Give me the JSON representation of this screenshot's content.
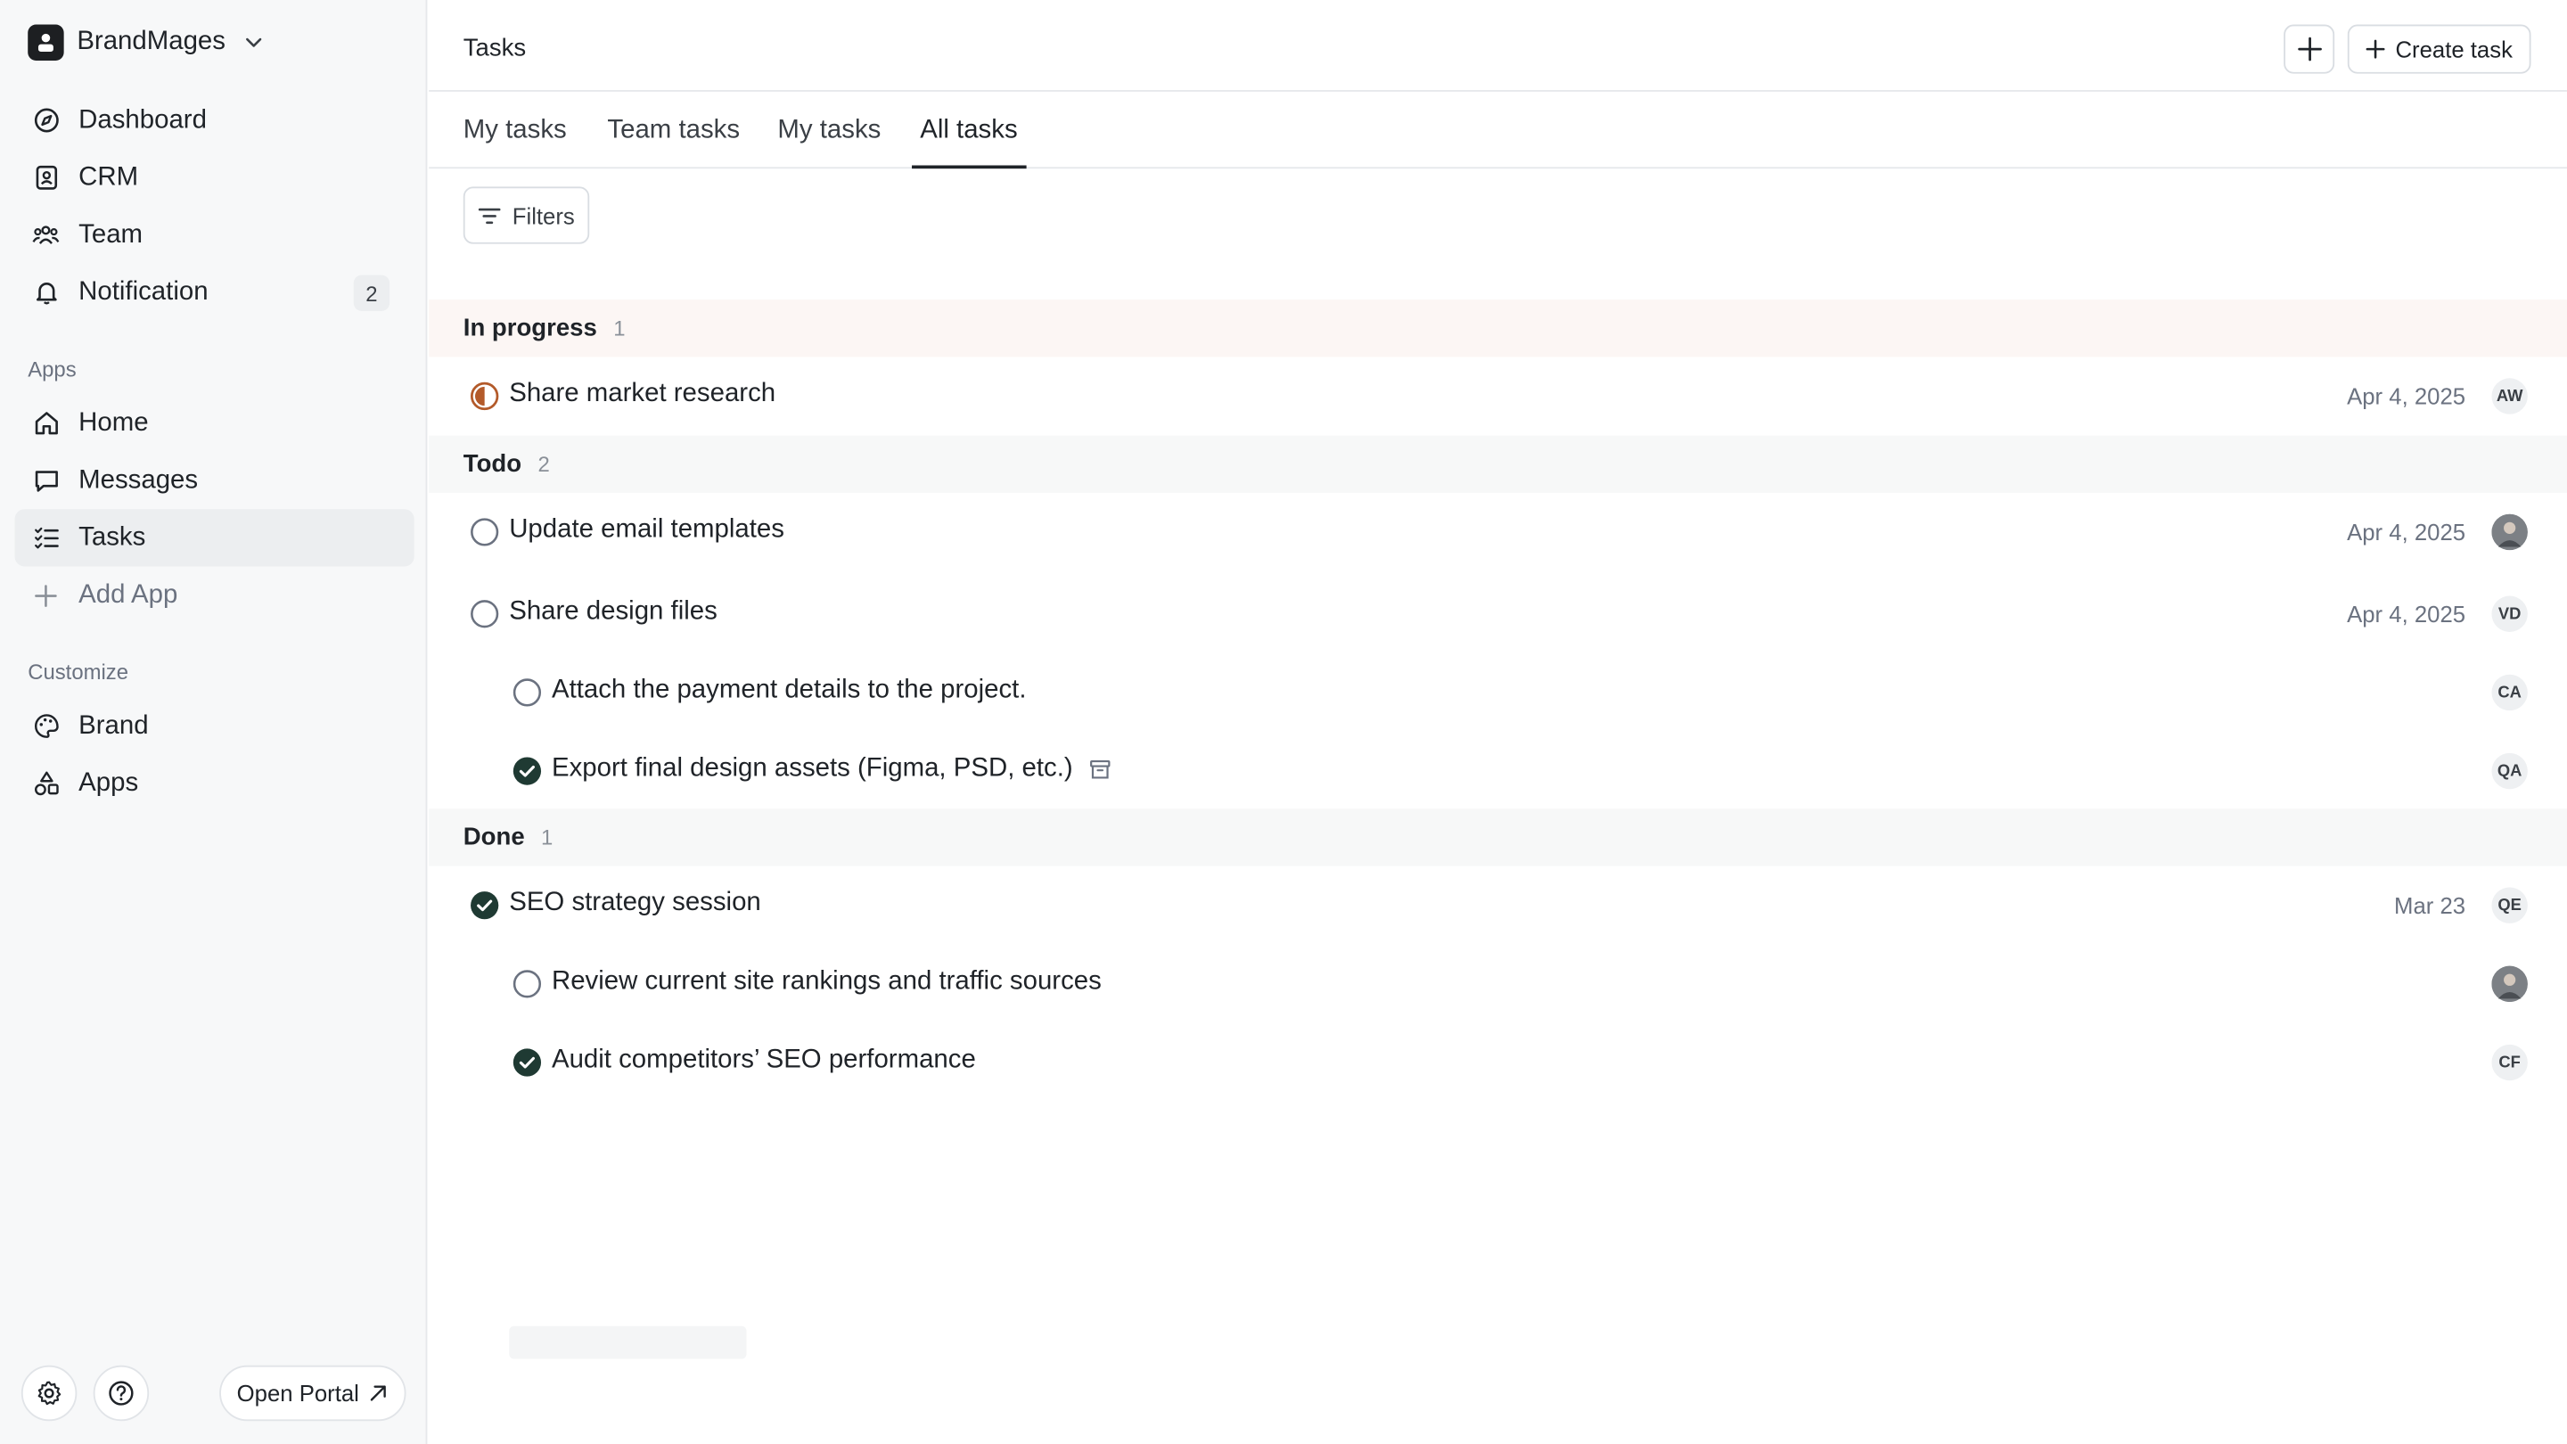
{
  "sidebar": {
    "workspace": "BrandMages",
    "nav": [
      {
        "label": "Dashboard",
        "icon": "compass-icon"
      },
      {
        "label": "CRM",
        "icon": "contact-book-icon"
      },
      {
        "label": "Team",
        "icon": "team-icon"
      },
      {
        "label": "Notification",
        "icon": "bell-icon",
        "badge": "2"
      }
    ],
    "apps_label": "Apps",
    "apps": [
      {
        "label": "Home",
        "icon": "home-icon"
      },
      {
        "label": "Messages",
        "icon": "message-icon"
      },
      {
        "label": "Tasks",
        "icon": "tasks-icon",
        "active": true
      },
      {
        "label": "Add App",
        "icon": "plus-icon"
      }
    ],
    "customize_label": "Customize",
    "customize": [
      {
        "label": "Brand",
        "icon": "palette-icon"
      },
      {
        "label": "Apps",
        "icon": "shapes-icon"
      }
    ],
    "open_portal": "Open Portal"
  },
  "header": {
    "title": "Tasks",
    "create_task": "Create task"
  },
  "tabs": [
    {
      "label": "My tasks"
    },
    {
      "label": "Team tasks"
    },
    {
      "label": "My tasks"
    },
    {
      "label": "All tasks",
      "active": true
    }
  ],
  "filters_label": "Filters",
  "groups": [
    {
      "name": "In progress",
      "count": "1",
      "tasks": [
        {
          "title": "Share market research",
          "date": "Apr 4, 2025",
          "assignee": "AW",
          "status": "in-progress"
        }
      ]
    },
    {
      "name": "Todo",
      "count": "2",
      "tasks": [
        {
          "title": "Update email templates",
          "date": "Apr 4, 2025",
          "assignee": "photo",
          "status": "todo"
        },
        {
          "title": "Share design files",
          "date": "Apr 4, 2025",
          "assignee": "VD",
          "status": "todo"
        },
        {
          "title": "Attach the payment details to the project.",
          "date": "",
          "assignee": "CA",
          "status": "todo",
          "subtask": true
        },
        {
          "title": "Export final design assets (Figma, PSD, etc.)",
          "date": "",
          "assignee": "QA",
          "status": "done",
          "subtask": true,
          "archived": true
        }
      ]
    },
    {
      "name": "Done",
      "count": "1",
      "tasks": [
        {
          "title": "SEO strategy session",
          "date": "Mar 23",
          "assignee": "QE",
          "status": "done"
        },
        {
          "title": "Review current site rankings and traffic sources",
          "date": "",
          "assignee": "photo",
          "status": "todo",
          "subtask": true
        },
        {
          "title": "Audit competitors’ SEO performance",
          "date": "",
          "assignee": "CF",
          "status": "done",
          "subtask": true
        }
      ]
    }
  ],
  "colors": {
    "accent_dark": "#1f3a33",
    "in_progress": "#b35a2a",
    "group_in_progress_bg": "#fcf6f4",
    "group_bg": "#f7f8f8"
  }
}
